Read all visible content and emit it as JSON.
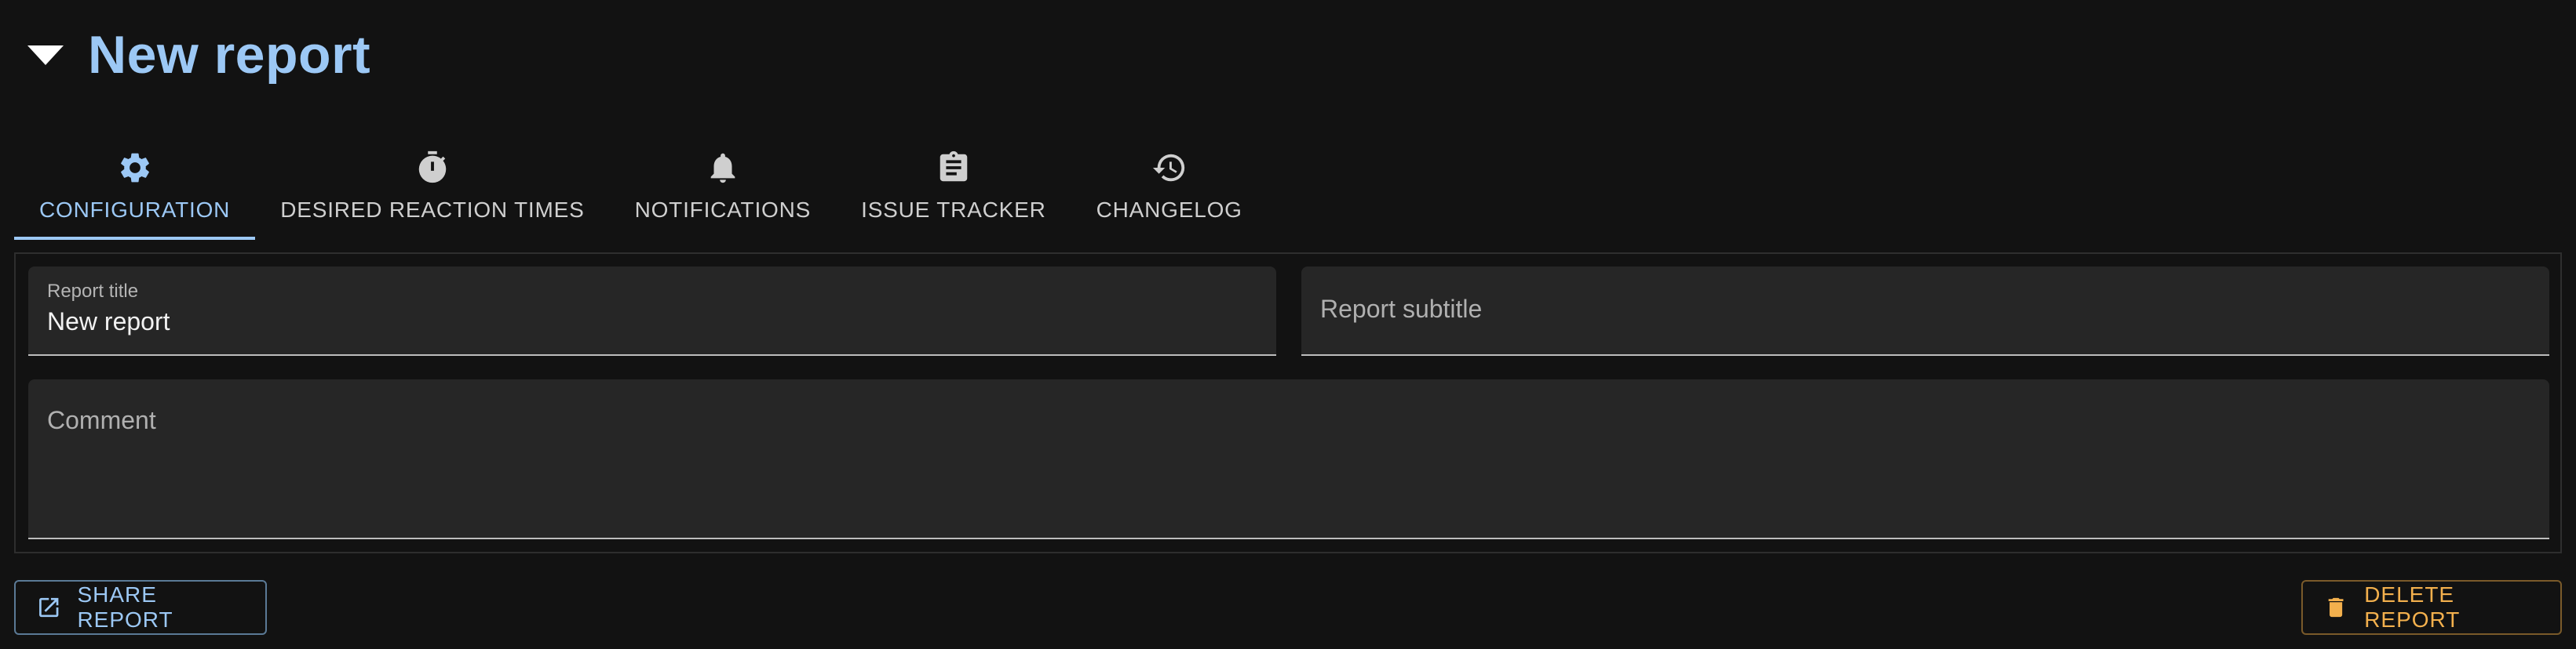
{
  "report": {
    "title": "New report"
  },
  "tabs": [
    {
      "label": "CONFIGURATION",
      "icon": "gear-icon",
      "active": true
    },
    {
      "label": "DESIRED REACTION TIMES",
      "icon": "stopwatch-icon",
      "active": false
    },
    {
      "label": "NOTIFICATIONS",
      "icon": "bell-icon",
      "active": false
    },
    {
      "label": "ISSUE TRACKER",
      "icon": "clipboard-icon",
      "active": false
    },
    {
      "label": "CHANGELOG",
      "icon": "history-icon",
      "active": false
    }
  ],
  "form": {
    "title_label": "Report title",
    "title_value": "New report",
    "subtitle_placeholder": "Report subtitle",
    "comment_placeholder": "Comment"
  },
  "actions": {
    "share_label": "SHARE REPORT",
    "delete_label": "DELETE REPORT"
  },
  "colors": {
    "background": "#121212",
    "accent": "#9cc8f5",
    "warning": "#f3b04d",
    "field_background": "#262626"
  }
}
